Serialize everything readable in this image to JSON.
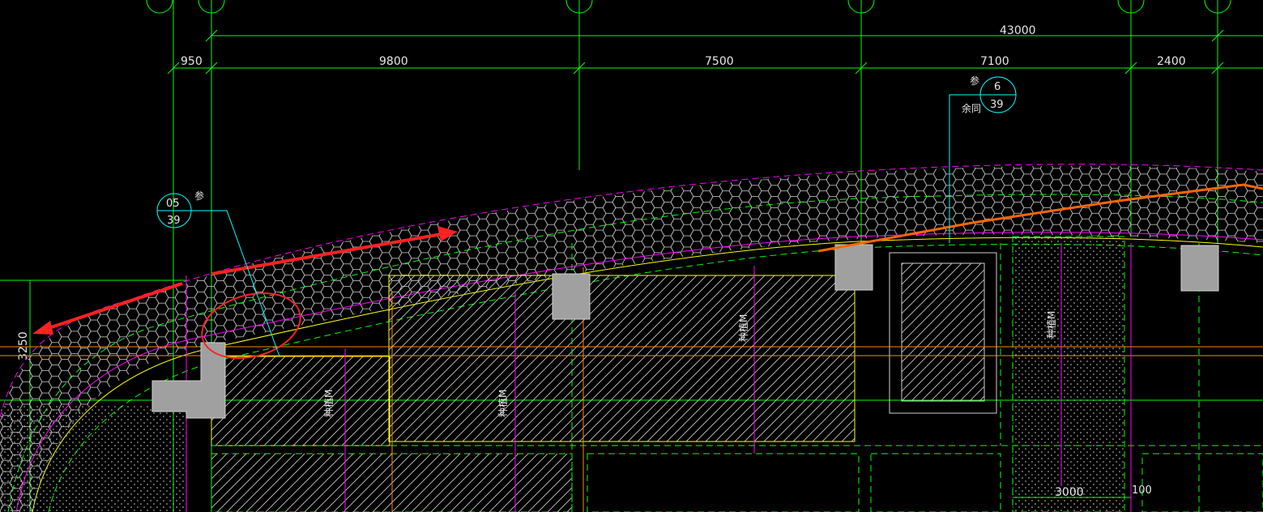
{
  "drawing": {
    "dimensions": {
      "overall": "43000",
      "spans": [
        "950",
        "9800",
        "7500",
        "7100",
        "2400"
      ],
      "left_edge": "3250",
      "bottom_width": "3000",
      "bottom_offset": "100"
    },
    "detail_callouts": [
      {
        "number": "05",
        "sheet": "39",
        "note": "参"
      },
      {
        "number": "6",
        "sheet": "39",
        "note": "参",
        "note2": "余同"
      }
    ],
    "zone_labels": [
      "种植M",
      "种植M",
      "种植M",
      "种植M"
    ],
    "colors": {
      "background": "#000000",
      "grid_green": "#00ff00",
      "magenta": "#ff00ff",
      "yellow": "#ffff00",
      "cyan": "#00ffff",
      "orange": "#ff6600",
      "red_annotation": "#ff2222",
      "column_gray": "#a0a0a0"
    }
  }
}
